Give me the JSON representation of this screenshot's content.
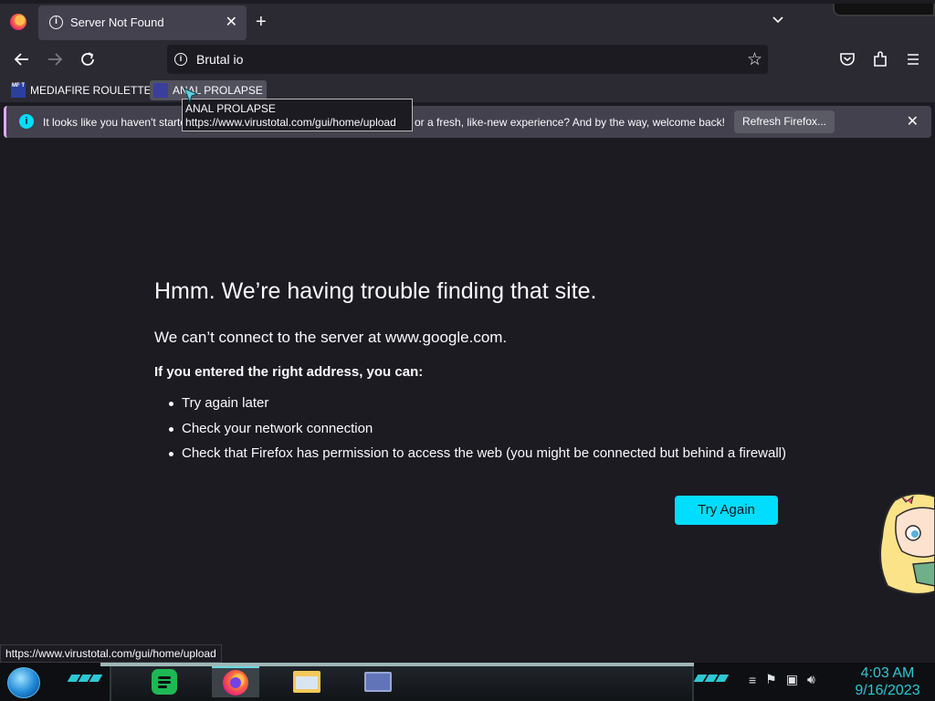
{
  "browser": {
    "tab": {
      "title": "Server Not Found"
    },
    "url": "Brutal io",
    "bookmarks": [
      {
        "label": "MEDIAFIRE ROULETTER",
        "favicon_text": "MF T"
      },
      {
        "label": "ANAL PROLAPSE"
      }
    ],
    "notification": {
      "text_before": "It looks like you haven't starte",
      "text_after": "or a fresh, like-new experience? And by the way, welcome back!",
      "button": "Refresh Firefox..."
    },
    "tooltip": {
      "title": "ANAL PROLAPSE",
      "url": "https://www.virustotal.com/gui/home/upload"
    },
    "status_url": "https://www.virustotal.com/gui/home/upload"
  },
  "error_page": {
    "title": "Hmm. We’re having trouble finding that site.",
    "subtitle": "We can’t connect to the server at www.google.com.",
    "lead": "If you entered the right address, you can:",
    "suggestions": [
      "Try again later",
      "Check your network connection",
      "Check that Firefox has permission to access the web (you might be connected but behind a firewall)"
    ],
    "button": "Try Again"
  },
  "taskbar": {
    "apps": [
      "spotify-icon",
      "firefox-icon",
      "file-explorer-icon",
      "window-icon"
    ],
    "clock": {
      "time": "4:03 AM",
      "date": "9/16/2023"
    }
  },
  "colors": {
    "accent": "#00ddff",
    "background": "#1c1b22",
    "toolbar": "#2b2a33"
  }
}
